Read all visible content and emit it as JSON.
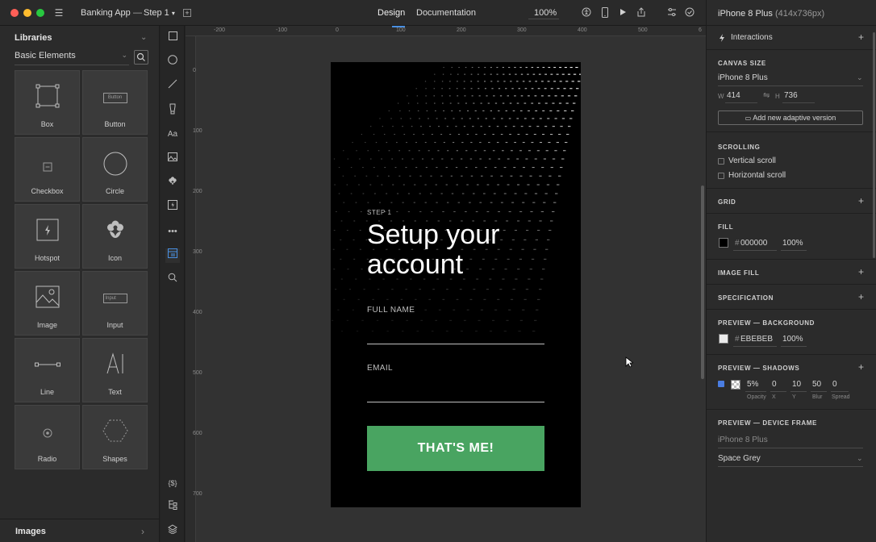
{
  "titlebar": {
    "app_title": "Banking App",
    "step": "Step 1",
    "tab_design": "Design",
    "tab_documentation": "Documentation",
    "zoom": "100%",
    "colors": {
      "close": "#fe5f57",
      "minimize": "#febc2e",
      "maximize": "#28c840"
    }
  },
  "libraries": {
    "title": "Libraries",
    "selected_library": "Basic Elements",
    "items": [
      {
        "label": "Box",
        "icon": "box-icon"
      },
      {
        "label": "Button",
        "icon": "button-icon"
      },
      {
        "label": "Checkbox",
        "icon": "checkbox-icon"
      },
      {
        "label": "Circle",
        "icon": "circle-icon"
      },
      {
        "label": "Hotspot",
        "icon": "hotspot-icon"
      },
      {
        "label": "Icon",
        "icon": "flower-icon"
      },
      {
        "label": "Image",
        "icon": "image-icon"
      },
      {
        "label": "Input",
        "icon": "input-icon"
      },
      {
        "label": "Line",
        "icon": "line-icon"
      },
      {
        "label": "Text",
        "icon": "text-icon"
      },
      {
        "label": "Radio",
        "icon": "radio-icon"
      },
      {
        "label": "Shapes",
        "icon": "hexagon-icon"
      }
    ],
    "button_glyph_text": "Button",
    "input_glyph_text": "Input",
    "images_section": "Images"
  },
  "rail": {
    "text_tool": "Aa",
    "code_tool": "{$}"
  },
  "rulers": {
    "top": [
      "-200",
      "-100",
      "0",
      "100",
      "200",
      "300",
      "400",
      "500",
      "6"
    ],
    "left": [
      "0",
      "100",
      "200",
      "300",
      "400",
      "500",
      "600",
      "700"
    ]
  },
  "screen": {
    "step_label": "STEP 1",
    "heading_line1": "Setup your",
    "heading_line2": "account",
    "full_name_label": "FULL NAME",
    "email_label": "EMAIL",
    "cta_label": "THAT'S ME!",
    "cta_color": "#49a461"
  },
  "inspector": {
    "device": "iPhone 8 Plus",
    "device_size": "(414x736px)",
    "interactions": "Interactions",
    "canvas_size": {
      "title": "CANVAS SIZE",
      "preset": "iPhone 8 Plus",
      "w_label": "W",
      "w_value": "414",
      "h_label": "H",
      "h_value": "736",
      "add_adaptive": "Add new adaptive version"
    },
    "scrolling": {
      "title": "SCROLLING",
      "vertical": "Vertical scroll",
      "horizontal": "Horizontal scroll"
    },
    "grid": {
      "title": "GRID"
    },
    "fill": {
      "title": "FILL",
      "hash": "#",
      "hex": "000000",
      "opacity": "100%",
      "swatch": "#000000"
    },
    "image_fill": {
      "title": "IMAGE FILL"
    },
    "specification": {
      "title": "SPECIFICATION"
    },
    "preview_background": {
      "title": "PREVIEW — BACKGROUND",
      "hash": "#",
      "hex": "EBEBEB",
      "opacity": "100%",
      "swatch": "#EBEBEB"
    },
    "preview_shadows": {
      "title": "PREVIEW — SHADOWS",
      "opacity": "5%",
      "x": "0",
      "y": "10",
      "blur": "50",
      "spread": "0",
      "opacity_label": "Opacity",
      "x_label": "X",
      "y_label": "Y",
      "blur_label": "Blur",
      "spread_label": "Spread"
    },
    "preview_device_frame": {
      "title": "PREVIEW — DEVICE FRAME",
      "device_placeholder": "iPhone 8 Plus",
      "color": "Space Grey"
    }
  }
}
